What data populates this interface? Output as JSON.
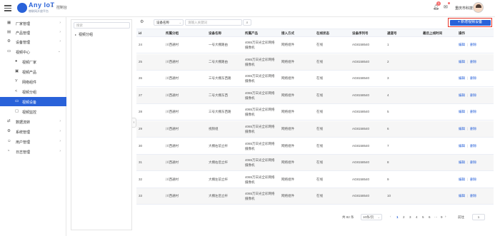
{
  "app": {
    "title": "Any IoT",
    "subtitle": "物联网开放平台",
    "home_label": "控制台"
  },
  "header": {
    "bell_badge": "3",
    "user_name": "重庆市科技"
  },
  "sidebar": {
    "items": [
      {
        "label": "厂家管理",
        "icon": "building-icon",
        "arrow": "›"
      },
      {
        "label": "产品管理",
        "icon": "product-icon",
        "arrow": "›"
      },
      {
        "label": "设备管理",
        "icon": "device-icon",
        "arrow": "›"
      },
      {
        "label": "视频中心",
        "icon": "video-center-icon",
        "arrow": "⌄"
      },
      {
        "label": "视频厂家",
        "icon": "camera-vendor-icon"
      },
      {
        "label": "视频产品",
        "icon": "video-product-icon"
      },
      {
        "label": "网络组件",
        "icon": "network-icon"
      },
      {
        "label": "视频分组",
        "icon": "share-icon"
      },
      {
        "label": "视频设备",
        "icon": "video-device-icon"
      },
      {
        "label": "视频监控",
        "icon": "monitor-icon"
      },
      {
        "label": "数据流转",
        "icon": "data-flow-icon",
        "arrow": "›"
      },
      {
        "label": "系统管理",
        "icon": "settings-icon",
        "arrow": "›"
      },
      {
        "label": "用户管理",
        "icon": "user-icon",
        "arrow": "›"
      },
      {
        "label": "日志管理",
        "icon": "log-icon",
        "arrow": "›"
      }
    ]
  },
  "tree": {
    "search_placeholder": "搜索",
    "root_label": "视频分组"
  },
  "toolbar": {
    "field_select": "设备名称",
    "search_placeholder": "请输入关键词",
    "add_button": "+ 新增视频设备"
  },
  "table": {
    "columns": [
      "id",
      "所属分组",
      "设备名称",
      "所属产品",
      "接入方式",
      "在线状态",
      "设备序列号",
      "通道号",
      "最后上线时间",
      "操作"
    ],
    "rows": [
      {
        "id": "24",
        "group": "川西通村",
        "name": "一号大棚路由",
        "product": "4065万日光全彩网络摄像机",
        "access": "网络组件",
        "status": "在线",
        "serial": "AG8158540",
        "channel": "1",
        "last_online": ""
      },
      {
        "id": "25",
        "group": "川西通村",
        "name": "二号大棚路由",
        "product": "4065万日光全彩网络摄像机",
        "access": "网络组件",
        "status": "在线",
        "serial": "AG8158540",
        "channel": "2",
        "last_online": ""
      },
      {
        "id": "26",
        "group": "川西通村",
        "name": "三号大棚东西路",
        "product": "4065万日光全彩网络摄像机",
        "access": "网络组件",
        "status": "在线",
        "serial": "AG8158540",
        "channel": "3",
        "last_online": ""
      },
      {
        "id": "27",
        "group": "川西通村",
        "name": "二号大棚东西",
        "product": "4065万日光全彩网络摄像机",
        "access": "网络组件",
        "status": "在线",
        "serial": "AG8158540",
        "channel": "4",
        "last_online": ""
      },
      {
        "id": "28",
        "group": "川西通村",
        "name": "三号大棚东西路",
        "product": "4065万日光全彩网络摄像机",
        "access": "网络组件",
        "status": "在线",
        "serial": "AG8158540",
        "channel": "5",
        "last_online": ""
      },
      {
        "id": "29",
        "group": "川西通村",
        "name": "视频组",
        "product": "4065万日光全彩网络摄像机",
        "access": "网络组件",
        "status": "在线",
        "serial": "AG8158540",
        "channel": "6",
        "last_online": ""
      },
      {
        "id": "30",
        "group": "川西通村",
        "name": "大棚右前立杆",
        "product": "4065万日光全彩网络摄像机",
        "access": "网络组件",
        "status": "在线",
        "serial": "AG8158540",
        "channel": "7",
        "last_online": ""
      },
      {
        "id": "31",
        "group": "川西通村",
        "name": "大棚右后立杆",
        "product": "4065万日光全彩网络摄像机",
        "access": "网络组件",
        "status": "在线",
        "serial": "AG8158540",
        "channel": "8",
        "last_online": ""
      },
      {
        "id": "32",
        "group": "川西通村",
        "name": "大棚左前立杆",
        "product": "4065万日光全彩网络摄像机",
        "access": "网络组件",
        "status": "在线",
        "serial": "AG8158540",
        "channel": "9",
        "last_online": ""
      },
      {
        "id": "33",
        "group": "川西通村",
        "name": "大棚左后立杆",
        "product": "4065万日光全彩网络摄像机",
        "access": "网络组件",
        "status": "在线",
        "serial": "AG8158540",
        "channel": "10",
        "last_online": ""
      }
    ],
    "op_edit": "编辑",
    "op_delete": "删除"
  },
  "pagination": {
    "total": "共 82 条",
    "page_size": "10条/页",
    "prev": "‹",
    "pages": [
      "1",
      "2",
      "3",
      "4",
      "5",
      "6",
      "···",
      "9"
    ],
    "next": "›",
    "goto_label": "前往",
    "goto_value": "1"
  },
  "colors": {
    "primary": "#2962d9",
    "highlight_border": "#e8372a",
    "badge": "#f56c6c"
  }
}
